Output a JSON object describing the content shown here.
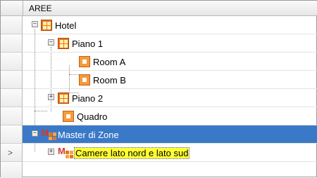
{
  "grid": {
    "column_header": "AREE",
    "rows": [
      {
        "label": "Hotel",
        "icon": "building-icon",
        "expander": "−"
      },
      {
        "label": "Piano 1",
        "icon": "building-icon",
        "expander": "−"
      },
      {
        "label": "Room A",
        "icon": "room-icon",
        "expander": ""
      },
      {
        "label": "Room B",
        "icon": "room-icon",
        "expander": ""
      },
      {
        "label": "Piano 2",
        "icon": "building-icon",
        "expander": "+"
      },
      {
        "label": "Quadro",
        "icon": "room-icon",
        "expander": ""
      },
      {
        "label": "Master di Zone",
        "icon": "master-zone-icon",
        "expander": "−",
        "selected": true
      },
      {
        "label": "Camere lato nord e lato sud",
        "icon": "master-zone-icon",
        "expander": "+",
        "highlighted": true
      }
    ],
    "current_row_indicator": ">"
  },
  "colors": {
    "selection": "#3a79c7",
    "highlight": "#ffff33",
    "icon_orange": "#e9741b"
  }
}
